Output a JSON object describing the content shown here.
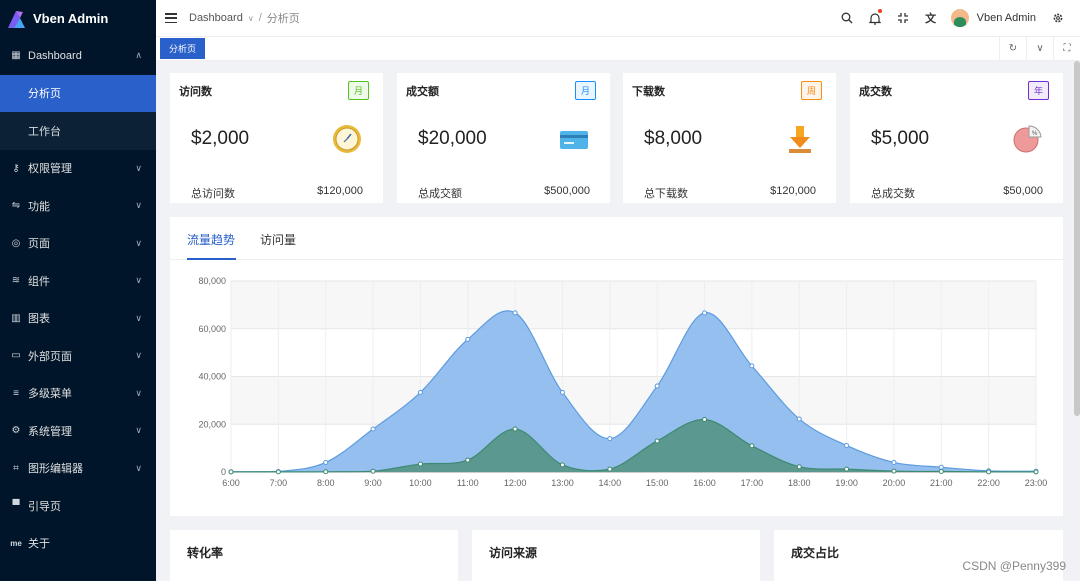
{
  "app": {
    "title": "Vben Admin"
  },
  "sidebar": {
    "items": [
      {
        "label": "Dashboard",
        "icon": "dashboard-icon",
        "glyph": "▦",
        "expanded": true,
        "children": [
          {
            "label": "分析页",
            "active": true
          },
          {
            "label": "工作台",
            "active": false
          }
        ]
      },
      {
        "label": "权限管理",
        "icon": "key-icon",
        "glyph": "⚷"
      },
      {
        "label": "功能",
        "icon": "function-icon",
        "glyph": "⇋"
      },
      {
        "label": "页面",
        "icon": "page-icon",
        "glyph": "◎"
      },
      {
        "label": "组件",
        "icon": "layers-icon",
        "glyph": "≋"
      },
      {
        "label": "图表",
        "icon": "chart-icon",
        "glyph": "▥"
      },
      {
        "label": "外部页面",
        "icon": "monitor-icon",
        "glyph": "▭"
      },
      {
        "label": "多级菜单",
        "icon": "menu-icon",
        "glyph": "≡"
      },
      {
        "label": "系统管理",
        "icon": "gear-icon",
        "glyph": "⚙"
      },
      {
        "label": "图形编辑器",
        "icon": "graph-icon",
        "glyph": "⌗"
      },
      {
        "label": "引导页",
        "icon": "guide-icon",
        "glyph": "▀",
        "noArrow": true
      },
      {
        "label": "关于",
        "icon": "about-icon",
        "glyph": "me",
        "noArrow": true
      }
    ]
  },
  "header": {
    "breadcrumb": [
      "Dashboard",
      "分析页"
    ],
    "user_name": "Vben Admin"
  },
  "tabs": {
    "active_label": "分析页"
  },
  "stats": [
    {
      "title": "访问数",
      "badge": "月",
      "badge_color": "#52c41a",
      "value": "$2,000",
      "foot_label": "总访问数",
      "foot_value": "$120,000",
      "icon": "clock-icon"
    },
    {
      "title": "成交额",
      "badge": "月",
      "badge_color": "#1890ff",
      "value": "$20,000",
      "foot_label": "总成交额",
      "foot_value": "$500,000",
      "icon": "card-icon"
    },
    {
      "title": "下载数",
      "badge": "周",
      "badge_color": "#fa8c16",
      "value": "$8,000",
      "foot_label": "总下载数",
      "foot_value": "$120,000",
      "icon": "download-icon"
    },
    {
      "title": "成交数",
      "badge": "年",
      "badge_color": "#722ed1",
      "value": "$5,000",
      "foot_label": "总成交数",
      "foot_value": "$50,000",
      "icon": "pie-icon"
    }
  ],
  "chart_tabs": {
    "tab1": "流量趋势",
    "tab2": "访问量"
  },
  "chart_data": {
    "type": "area",
    "x": [
      "6:00",
      "7:00",
      "8:00",
      "9:00",
      "10:00",
      "11:00",
      "12:00",
      "13:00",
      "14:00",
      "15:00",
      "16:00",
      "17:00",
      "18:00",
      "19:00",
      "20:00",
      "21:00",
      "22:00",
      "23:00"
    ],
    "series": [
      {
        "values": [
          111,
          222,
          4000,
          18000,
          33333,
          55555,
          66666,
          33333,
          14000,
          36000,
          66666,
          44444,
          22222,
          11111,
          4000,
          2000,
          500,
          333
        ],
        "color": "#8fbcee",
        "stroke": "#5d9be0"
      },
      {
        "values": [
          33,
          66,
          88,
          333,
          3333,
          5000,
          18000,
          3000,
          1200,
          13000,
          22000,
          11000,
          2221,
          1201,
          390,
          198,
          60,
          30
        ],
        "color": "#579689",
        "stroke": "#3d8a72"
      }
    ],
    "ylim": [
      0,
      80000
    ],
    "yticks": [
      "0",
      "20,000",
      "40,000",
      "60,000",
      "80,000"
    ],
    "grid": true
  },
  "bottom_cards": [
    "转化率",
    "访问来源",
    "成交占比"
  ],
  "watermark": "CSDN @Penny399"
}
